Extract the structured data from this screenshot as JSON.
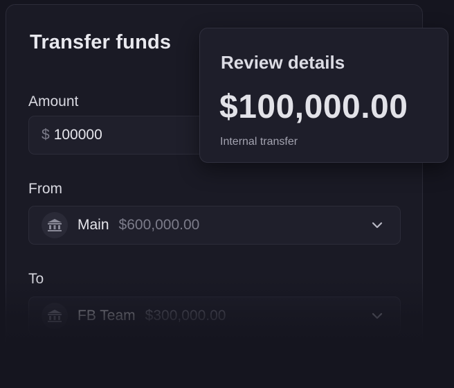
{
  "transfer": {
    "title": "Transfer funds",
    "amount": {
      "label": "Amount",
      "currency_symbol": "$",
      "value": "100000"
    },
    "from": {
      "label": "From",
      "account_name": "Main",
      "balance": "$600,000.00",
      "icon": "bank-icon"
    },
    "to": {
      "label": "To",
      "account_name": "FB Team",
      "balance": "$300,000.00",
      "icon": "bank-icon"
    }
  },
  "review": {
    "title": "Review details",
    "amount": "$100,000.00",
    "subtitle": "Internal transfer"
  },
  "colors": {
    "background": "#15151f",
    "card": "#1a1a25",
    "input": "#1f1f2b",
    "muted_text": "#7c7c8a"
  }
}
